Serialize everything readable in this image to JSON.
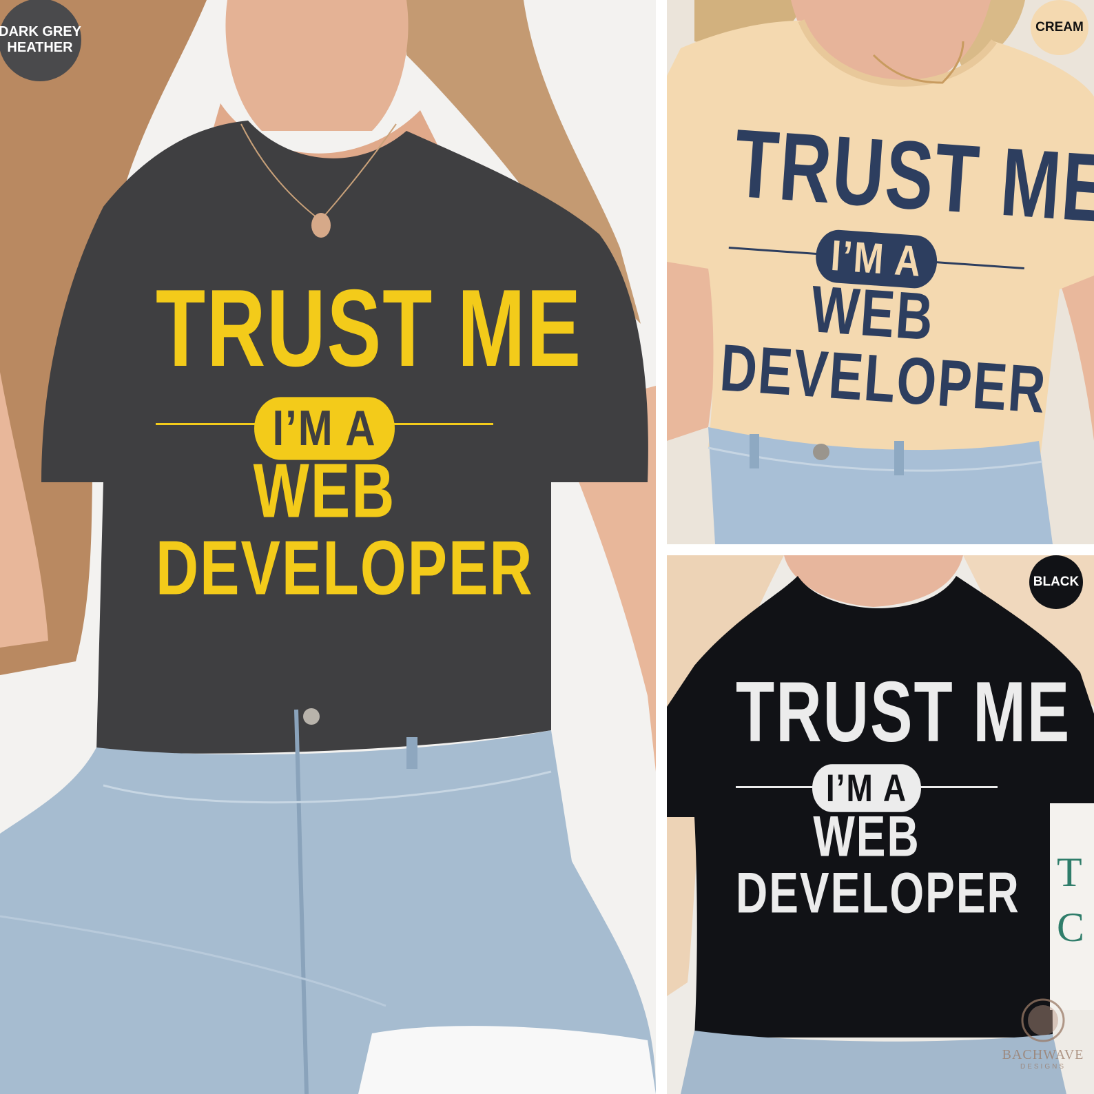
{
  "colors": {
    "grey_shirt": "#3f3f41",
    "yellow_print": "#f3cb1a",
    "cream_shirt": "#f4d9b0",
    "navy_print": "#2d3e5f",
    "black_shirt": "#111216",
    "white_print": "#ececec",
    "denim": "#9fb6cc",
    "skin": "#e6b497"
  },
  "variants": [
    {
      "badge": [
        "DARK GREY",
        "HEATHER"
      ],
      "design": {
        "line1": "TRUST ME",
        "pill": "I’M A",
        "line3": "WEB",
        "line4": "DEVELOPER"
      }
    },
    {
      "badge": [
        "CREAM"
      ],
      "design": {
        "line1": "TRUST ME",
        "pill": "I’M A",
        "line3": "WEB",
        "line4": "DEVELOPER"
      }
    },
    {
      "badge": [
        "BLACK"
      ],
      "design": {
        "line1": "TRUST ME",
        "pill": "I’M A",
        "line3": "WEB",
        "line4": "DEVELOPER"
      }
    }
  ],
  "watermark": {
    "brand": "BACHWAVE",
    "sub": "DESIGNS"
  }
}
